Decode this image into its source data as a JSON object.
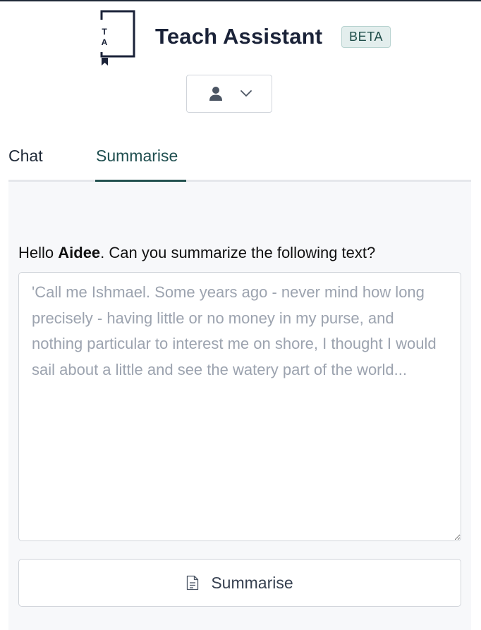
{
  "header": {
    "logo_letters": [
      "T",
      "A"
    ],
    "app_title": "Teach Assistant",
    "beta_label": "BETA"
  },
  "user_menu": {
    "user_icon": "user-icon",
    "chevron_icon": "chevron-down-icon"
  },
  "tabs": [
    {
      "label": "Chat",
      "active": false
    },
    {
      "label": "Summarise",
      "active": true
    }
  ],
  "summarise": {
    "greeting_prefix": "Hello ",
    "user_name": "Aidee",
    "greeting_suffix": ". Can you summarize the following text?",
    "input_value": "",
    "input_placeholder": "'Call me Ishmael. Some years ago - never mind how long precisely - having little or no money in my purse, and nothing particular to interest me on shore, I thought I would sail about a little and see the watery part of the world...",
    "button_label": "Summarise",
    "button_icon": "document-icon"
  },
  "colors": {
    "brand_dark": "#1a2238",
    "accent_teal": "#23514f",
    "beta_bg": "#e3eeed",
    "panel_bg": "#f7f8fa",
    "placeholder": "#9ca3af"
  }
}
